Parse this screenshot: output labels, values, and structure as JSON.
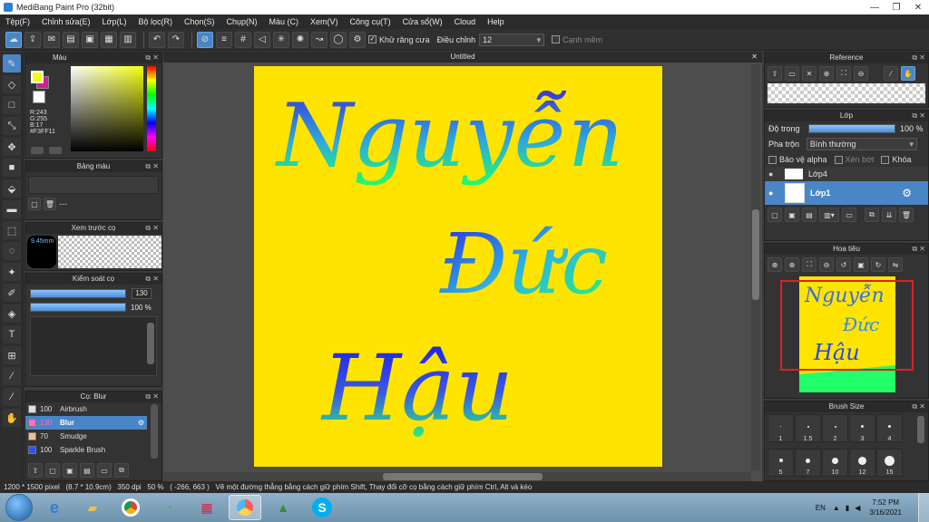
{
  "window": {
    "title": "MediBang Paint Pro (32bit)",
    "min": "—",
    "max": "❐",
    "close": "✕"
  },
  "menu": [
    "Tệp(F)",
    "Chỉnh sửa(E)",
    "Lớp(L)",
    "Bộ lọc(R)",
    "Chọn(S)",
    "Chụp(N)",
    "Màu (C)",
    "Xem(V)",
    "Công cụ(T)",
    "Cửa sổ(W)",
    "Cloud",
    "Help"
  ],
  "toolbar": {
    "antialias_label": "Khử răng cưa",
    "correction_label": "Điều chỉnh",
    "correction_value": "12",
    "edge_label": "Cạnh mềm"
  },
  "panels": {
    "color": {
      "title": "Màu",
      "r": "R:243",
      "g": "G:255",
      "b": "B:17",
      "hex": "#F3FF11",
      "fg": "#f3ff11",
      "bg": "#d81b8f"
    },
    "palette": {
      "title": "Bảng màu",
      "dash": "---"
    },
    "brush_preview": {
      "title": "Xem trước cọ",
      "size": "9.45mm"
    },
    "brush_control": {
      "title": "Kiểm soát cọ",
      "size_value": "130",
      "opacity_value": "100 %"
    },
    "brush_list": {
      "title": "Cọ: Blur",
      "items": [
        {
          "size": "100",
          "name": "Airbrush",
          "color": "#e0e0e0",
          "selected": false
        },
        {
          "size": "130",
          "name": "Blur",
          "color": "#ff6ec7",
          "selected": true
        },
        {
          "size": "70",
          "name": "Smudge",
          "color": "#f5c08a",
          "selected": false
        },
        {
          "size": "100",
          "name": "Sparkle Brush",
          "color": "#3050ff",
          "selected": false
        }
      ]
    },
    "reference": {
      "title": "Reference"
    },
    "layer": {
      "title": "Lớp",
      "opacity_label": "Độ trong",
      "opacity_value": "100 %",
      "blend_label": "Pha trộn",
      "blend_value": "Bình thường",
      "protect_alpha": "Bảo vệ alpha",
      "clipping": "Xén bớt",
      "lock": "Khóa",
      "layers": [
        {
          "name": "Lớp4",
          "selected": false
        },
        {
          "name": "Lớp1",
          "selected": true
        }
      ]
    },
    "navigator": {
      "title": "Hoa tiêu"
    },
    "brush_size": {
      "title": "Brush Size",
      "sizes": [
        "1",
        "1.5",
        "2",
        "3",
        "4",
        "5",
        "7",
        "10",
        "12",
        "15"
      ]
    }
  },
  "document": {
    "tab": "Untitled",
    "artwork_lines": [
      "Nguyễn",
      "Đức",
      "Hậu"
    ],
    "background": "#ffe400"
  },
  "status": {
    "dimensions": "1200 * 1500 pixel",
    "physical": "(8.7 * 10.9cm)",
    "dpi": "350 dpi",
    "zoom": "50 %",
    "coords": "( -266, 663 )",
    "hint": "Vẽ một đường thẳng bằng cách giữ phím Shift, Thay đổi cỡ cọ bằng cách giữ phím Ctrl, Alt và kéo"
  },
  "taskbar": {
    "lang": "EN",
    "time": "7:52 PM",
    "date": "3/16/2021"
  }
}
